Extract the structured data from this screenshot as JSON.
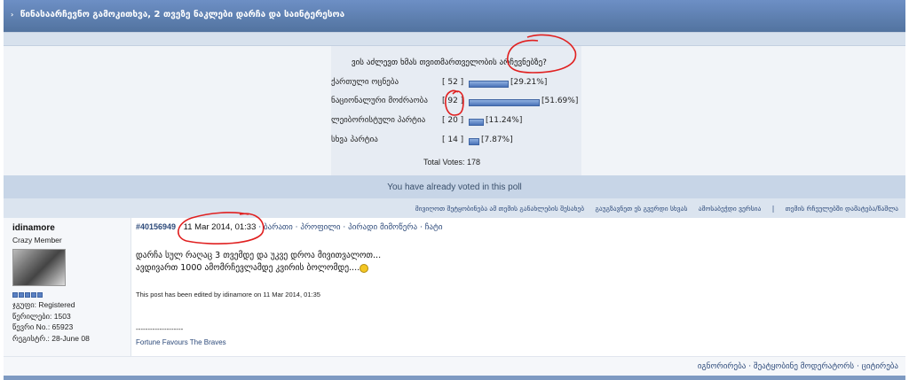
{
  "topic": {
    "title": "წინასაარჩევნო გამოკითხვა, 2 თვეზე ნაკლები დარჩა და საინტერესოა"
  },
  "poll": {
    "question": "ვის აძლევთ ხმას თვითმართველობის არჩევნებზე?",
    "options": [
      {
        "label": "ქართული ოცნება",
        "count": "[ 52 ]",
        "percent": "[29.21%]",
        "value": 29.21
      },
      {
        "label": "ნაციონალური მოძრაობა",
        "count": "[ 92 ]",
        "percent": "[51.69%]",
        "value": 51.69
      },
      {
        "label": "ლეიბორისტული პარტია",
        "count": "[ 20 ]",
        "percent": "[11.24%]",
        "value": 11.24
      },
      {
        "label": "სხვა პარტია",
        "count": "[ 14 ]",
        "percent": "[7.87%]",
        "value": 7.87
      }
    ],
    "total": "Total Votes: 178",
    "voted_notice": "You have already voted in this poll"
  },
  "topic_links": [
    "მივიღოთ შეტყობინება ამ თემის განახლების შესახებ",
    "გაუგზავნეთ ეს გვერდი სხვას",
    "ამოსაბეჭდი ვერსია",
    "|",
    "თემის რჩეულებში დამატება/წაშლა"
  ],
  "post": {
    "username": "idinamore",
    "rank": "Crazy Member",
    "group": "ჯგუფი: Registered",
    "posts": "წერილები: 1503",
    "member_no": "წევრი No.: 65923",
    "registered": "რეგისტრ.: 28-June 08",
    "post_id": "#40156949",
    "date": "11 Mar 2014, 01:33",
    "actions": [
      "ბარათი",
      "პროფილი",
      "პირადი მიმოწერა",
      "ჩატი"
    ],
    "line1": "დარჩა სულ რაღაც 3 თვემდე და უკვე დროა მივითვალოთ...",
    "line2": "ავდივართ 1000 ამომრჩევლამდე კვირის ბოლომდე....",
    "edited": "This post has been edited by idinamore on 11 Mar 2014, 01:35",
    "sig_divider": "--------------------",
    "signature": "Fortune Favours The Braves",
    "smiley_icon": "smiley-icon"
  },
  "post_buttons": [
    "იგნორირება",
    "შეატყობინე მოდერატორს",
    "ციტირება"
  ]
}
